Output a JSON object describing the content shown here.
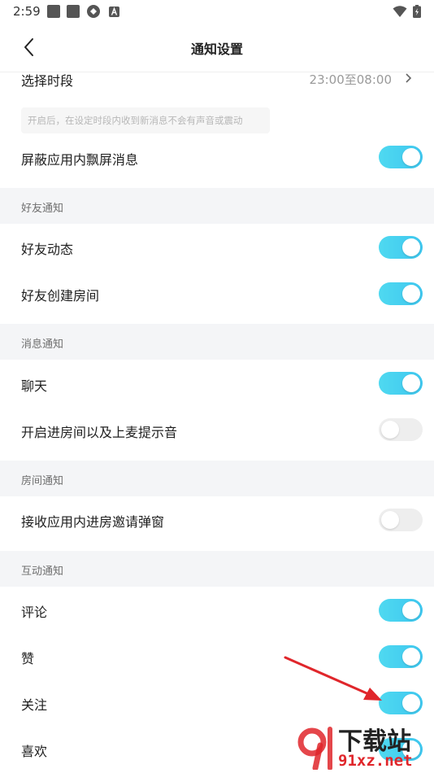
{
  "status_bar": {
    "time": "2:59"
  },
  "header": {
    "title": "通知设置"
  },
  "time_range": {
    "label": "选择时段",
    "value": "23:00至08:00"
  },
  "hint": "开启后，在设定时段内收到新消息不会有声音或震动",
  "block_floating": {
    "label": "屏蔽应用内飘屏消息",
    "on": true
  },
  "sections": {
    "friend": {
      "title": "好友通知",
      "items": [
        {
          "label": "好友动态",
          "on": true
        },
        {
          "label": "好友创建房间",
          "on": true
        }
      ]
    },
    "message": {
      "title": "消息通知",
      "items": [
        {
          "label": "聊天",
          "on": true
        },
        {
          "label": "开启进房间以及上麦提示音",
          "on": false
        }
      ]
    },
    "room": {
      "title": "房间通知",
      "items": [
        {
          "label": "接收应用内进房邀请弹窗",
          "on": false
        }
      ]
    },
    "interaction": {
      "title": "互动通知",
      "items": [
        {
          "label": "评论",
          "on": true
        },
        {
          "label": "赞",
          "on": true
        },
        {
          "label": "关注",
          "on": true
        },
        {
          "label": "喜欢",
          "on": true
        }
      ]
    }
  },
  "watermark": {
    "brand": "下载站",
    "domain": "91xz.net"
  },
  "colors": {
    "toggle_on": "#3ec7ef",
    "toggle_off": "#eeeeee",
    "section_bg": "#f4f5f7",
    "arrow": "#e0262b"
  }
}
